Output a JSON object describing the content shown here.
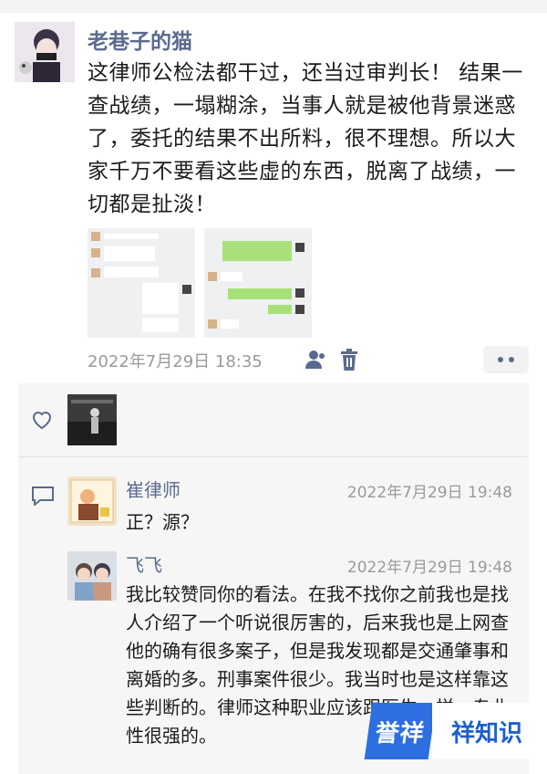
{
  "post": {
    "author": "老巷子的猫",
    "text": "这律师公检法都干过，还当过审判长！ 结果一查战绩，一塌糊涂，当事人就是被他背景迷惑了，委托的结果不出所料，很不理想。所以大家千万不要看这些虚的东西，脱离了战绩，一切都是扯淡！",
    "timestamp": "2022年7月29日 18:35",
    "icons": [
      "person-icon",
      "trash-icon",
      "more-icon"
    ]
  },
  "comments": [
    {
      "name": "崔律师",
      "time": "2022年7月29日 19:48",
      "text": "正？源？"
    },
    {
      "name": "飞飞",
      "time": "2022年7月29日 19:48",
      "text": "我比较赞同你的看法。在我不找你之前我也是找人介绍了一个听说很厉害的，后来我也是上网查他的确有很多案子，但是我发现都是交通肇事和离婚的多。刑事案件很少。我当时也是这样靠这些判断的。律师这种职业应该跟医生一样，专业性很强的。"
    }
  ],
  "watermark": {
    "badge": "誉祥",
    "text": "祥知识"
  },
  "colors": {
    "name_link": "#5b6a91",
    "time_gray": "#9a9a9a",
    "comment_bg": "#f6f6f6",
    "watermark_blue": "#2d6fe0"
  }
}
